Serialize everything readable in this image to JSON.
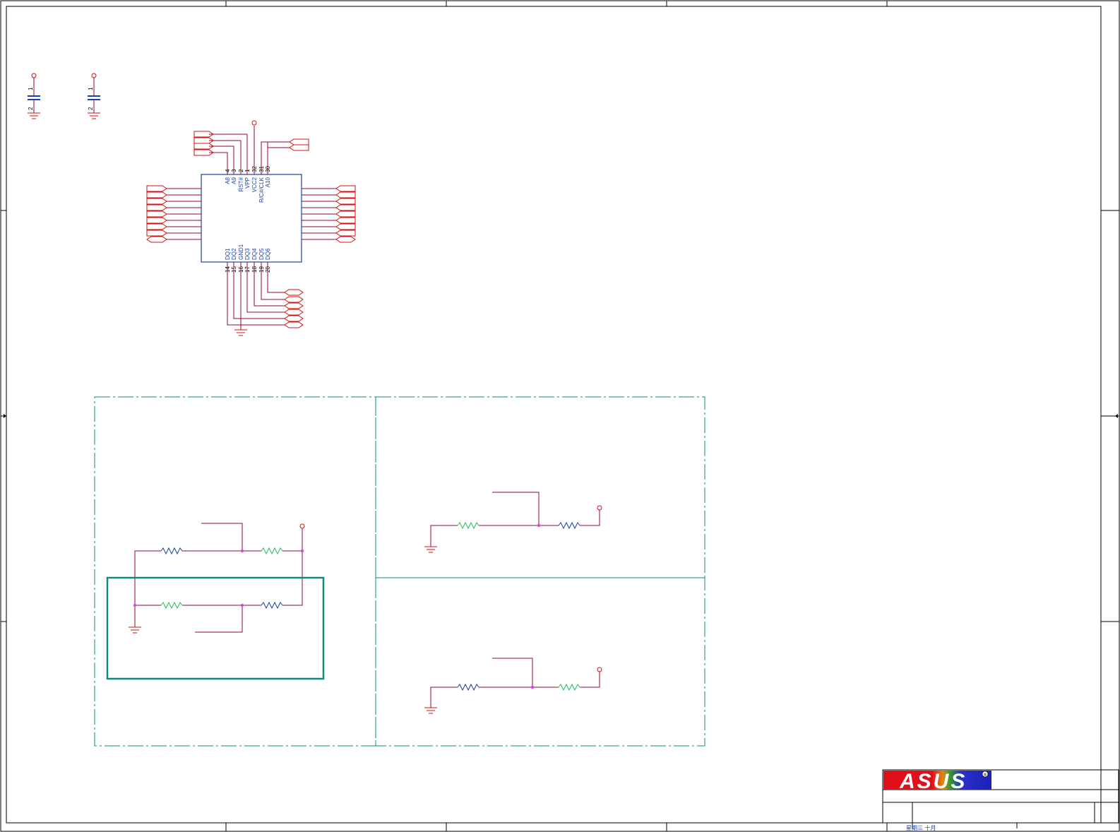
{
  "chip": {
    "top_pin_numbers": [
      "4",
      "3",
      "2",
      "1",
      "32",
      "31",
      "30"
    ],
    "top_pin_names": [
      "A8",
      "A9",
      "RST#",
      "VPP",
      "VCC2",
      "R/C#/CLK",
      "A10"
    ],
    "bottom_pin_numbers": [
      "14",
      "15",
      "16",
      "17",
      "18",
      "19",
      "20"
    ],
    "bottom_pin_names": [
      "DQ1",
      "DQ2",
      "GND1",
      "DQ3",
      "DQ4",
      "DQ5",
      "DQ6"
    ]
  },
  "decoupling_caps": [
    {
      "pin1": "1",
      "pin2": "2"
    },
    {
      "pin1": "1",
      "pin2": "2"
    }
  ],
  "title_block": {
    "logo_text": "ASUS",
    "registered_mark": "®",
    "date_text": "星期三 十月"
  },
  "colors": {
    "sheet_border": "#000000",
    "wire": "#8b0a3a",
    "net_port": "#d01010",
    "component_body": "#1a3fa8",
    "alt_resistor": "#22c25a",
    "junction": "#e040e0",
    "section_dash": "#0e8a7e",
    "highlight_box": "#0e8a7e"
  }
}
